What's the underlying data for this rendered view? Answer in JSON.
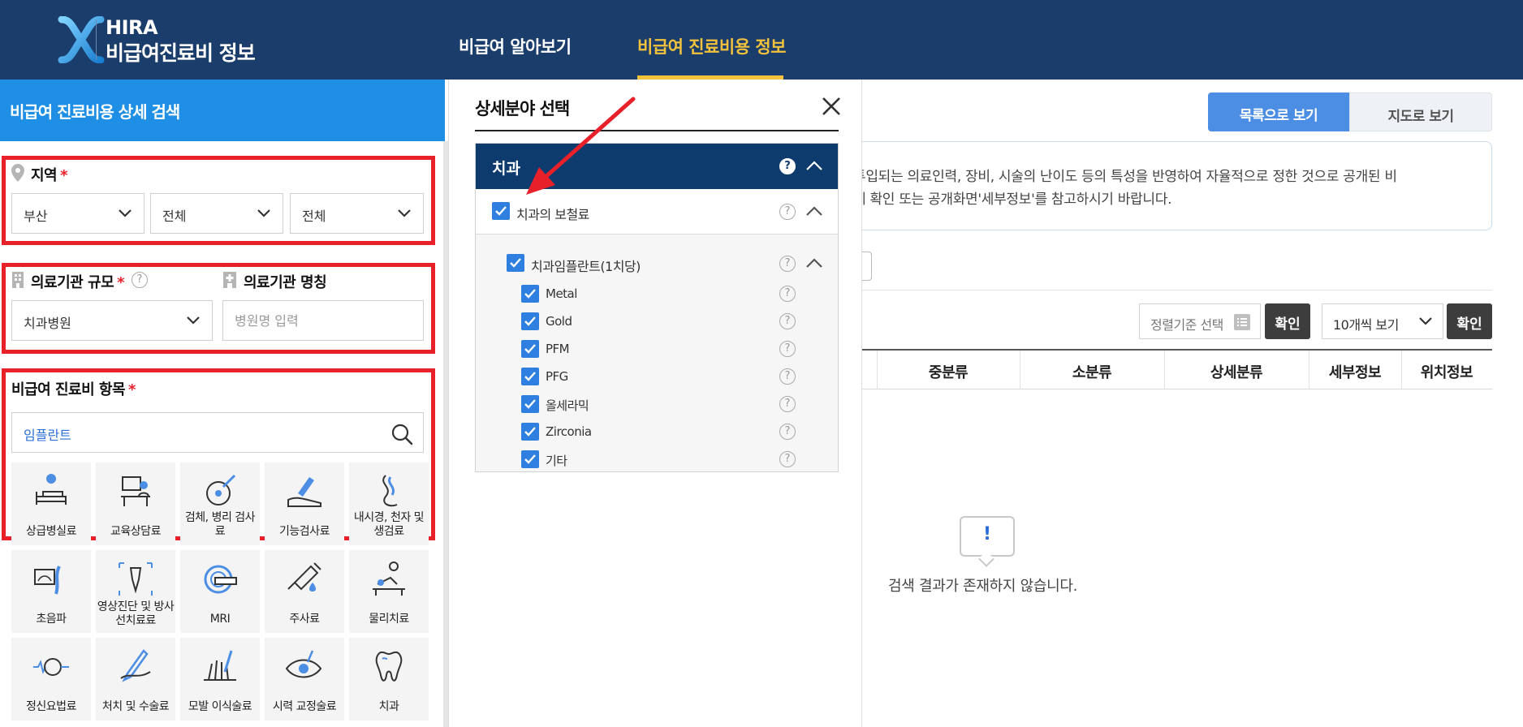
{
  "header": {
    "brand_top": "HIRA",
    "brand_bottom": "비급여진료비 정보",
    "nav": [
      {
        "label": "비급여 알아보기",
        "active": false
      },
      {
        "label": "비급여 진료비용 정보",
        "active": true
      }
    ]
  },
  "left_panel": {
    "title": "비급여 진료비용 상세 검색",
    "region": {
      "label": "지역",
      "required": "*",
      "selects": [
        "부산",
        "전체",
        "전체"
      ]
    },
    "institution": {
      "scale_label": "의료기관 규모",
      "scale_required": "*",
      "scale_value": "치과병원",
      "name_label": "의료기관 명칭",
      "name_placeholder": "병원명 입력"
    },
    "item": {
      "label": "비급여 진료비 항목",
      "required": "*",
      "value": "임플란트"
    },
    "categories": [
      {
        "label": "상급병실료",
        "icon": "hospital-bed-icon"
      },
      {
        "label": "교육상담료",
        "icon": "consultation-icon"
      },
      {
        "label": "검체, 병리 검사료",
        "icon": "specimen-icon"
      },
      {
        "label": "기능검사료",
        "icon": "function-test-icon"
      },
      {
        "label": "내시경, 천자 및 생검료",
        "icon": "endoscope-icon"
      },
      {
        "label": "초음파",
        "icon": "ultrasound-icon"
      },
      {
        "label": "영상진단 및 방사선치료료",
        "icon": "imaging-icon"
      },
      {
        "label": "MRI",
        "icon": "mri-icon"
      },
      {
        "label": "주사료",
        "icon": "syringe-icon"
      },
      {
        "label": "물리치료",
        "icon": "physical-therapy-icon"
      },
      {
        "label": "정신요법료",
        "icon": "brain-icon"
      },
      {
        "label": "처치 및 수술료",
        "icon": "surgery-icon"
      },
      {
        "label": "모발 이식술료",
        "icon": "hair-transplant-icon"
      },
      {
        "label": "시력 교정술료",
        "icon": "eye-icon"
      },
      {
        "label": "치과",
        "icon": "tooth-icon"
      }
    ]
  },
  "popup": {
    "title": "상세분야 선택",
    "header": "치과",
    "level1": "치과의 보철료",
    "level2": "치과임플란트(1치당)",
    "items": [
      "Metal",
      "Gold",
      "PFM",
      "PFG",
      "올세라믹",
      "Zirconia",
      "기타"
    ],
    "help": "?"
  },
  "main": {
    "view_list": "목록으로 보기",
    "view_map": "지도로 보기",
    "notice_line1": "투입되는 의료인력, 장비, 시술의 난이도 등의 특성을 반영하여 자율적으로 정한 것으로 공개된 비",
    "notice_line2": "에 확인 또는 공개화면'세부정보'를 참고하시기 바랍니다.",
    "sort_placeholder": "정렬기준 선택",
    "confirm": "확인",
    "page_size": "10개씩 보기",
    "columns": [
      "중분류",
      "소분류",
      "상세분류",
      "세부정보",
      "위치정보"
    ],
    "empty_mark": "!",
    "empty_message": "검색 결과가 존재하지 않습니다."
  },
  "colors": {
    "header_bg": "#1b3d6b",
    "nav_active": "#f3c23c",
    "left_title_bg": "#1f8fe6",
    "highlight_red": "#e8202a",
    "tree_head_bg": "#0e3b6e",
    "checkbox_blue": "#2f7fe0",
    "list_button_blue": "#4c8ee4"
  }
}
